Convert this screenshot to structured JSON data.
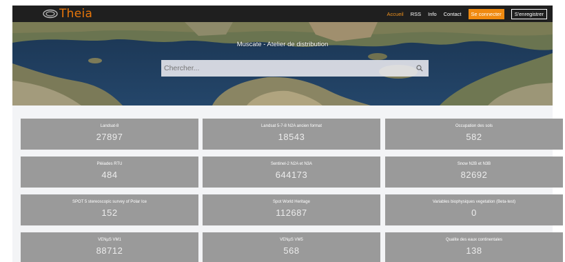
{
  "header": {
    "logo_text": "Theia",
    "nav": [
      {
        "label": "Accueil",
        "active": true
      },
      {
        "label": "RSS"
      },
      {
        "label": "Info"
      },
      {
        "label": "Contact"
      }
    ],
    "login_label": "Se connecter",
    "register_label": "S'enregistrer",
    "accent_color": "#f08a10"
  },
  "hero": {
    "title": "Muscate - Atelier de distribution",
    "search_placeholder": "Chercher...",
    "search_icon": "search-icon"
  },
  "collections": [
    {
      "label": "Landsat-8",
      "count": "27897"
    },
    {
      "label": "Landsat 5-7-8 N2A ancien format",
      "count": "18543"
    },
    {
      "label": "Occupation des sols",
      "count": "582"
    },
    {
      "label": "Pléiades RTU",
      "count": "484"
    },
    {
      "label": "Sentinel-2 N2A et N3A",
      "count": "644173"
    },
    {
      "label": "Snow N2B et N3B",
      "count": "82692"
    },
    {
      "label": "SPOT 5 stereoscopic survey of Polar Ice",
      "count": "152"
    },
    {
      "label": "Spot World Heritage",
      "count": "112687"
    },
    {
      "label": "Variables biophysiques vegetation (Beta-test)",
      "count": "0"
    },
    {
      "label": "VENµS VM1",
      "count": "88712"
    },
    {
      "label": "VENµS VM5",
      "count": "568"
    },
    {
      "label": "Qualite des eaux continentales",
      "count": "138"
    }
  ],
  "colors": {
    "tile_bg": "#9a9a9a",
    "navbar_bg": "#1f1f1f"
  }
}
